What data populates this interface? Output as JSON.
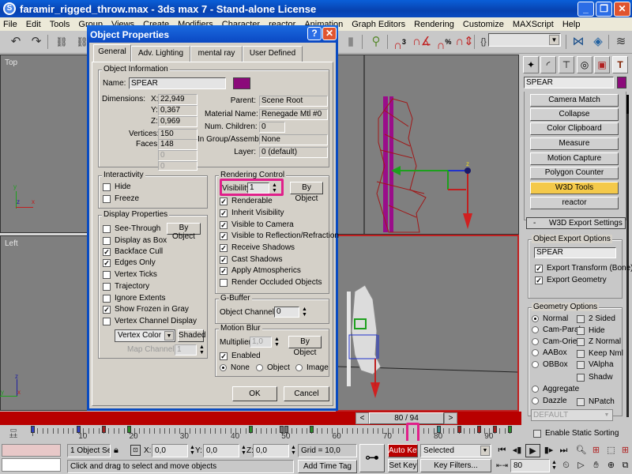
{
  "app": {
    "title": "faramir_rigged_throw.max - 3ds max 7  - Stand-alone License",
    "window_buttons": [
      "minimize",
      "restore",
      "close"
    ]
  },
  "menu": [
    "File",
    "Edit",
    "Tools",
    "Group",
    "Views",
    "Create",
    "Modifiers",
    "Character",
    "reactor",
    "Animation",
    "Graph Editors",
    "Rendering",
    "Customize",
    "MAXScript",
    "Help"
  ],
  "toolbar": {
    "icons": [
      "undo-icon",
      "redo-icon",
      "select-link-icon",
      "unlink-icon",
      "bind-space-warp-icon",
      "snap-3d-icon",
      "angle-snap-icon",
      "percent-snap-icon",
      "spinner-snap-icon",
      "edit-named-selection-icon",
      "mirror-icon",
      "align-icon",
      "layer-manager-icon"
    ],
    "snap_labels": {
      "snap3": "3",
      "percent": "%"
    },
    "named_selection_value": ""
  },
  "viewports": {
    "top_label": "Top",
    "left_label": "Left",
    "axis_top": {
      "y": "y",
      "z": "z",
      "x": "x"
    },
    "axis_left": {
      "z": "z",
      "y": "y",
      "x": "x"
    },
    "gizmo_label": "z"
  },
  "dialog": {
    "title": "Object Properties",
    "tabs": [
      "General",
      "Adv. Lighting",
      "mental ray",
      "User Defined"
    ],
    "active_tab": "General",
    "object_info": {
      "group_label": "Object Information",
      "name_label": "Name:",
      "name_value": "SPEAR",
      "color": "#8b0a7a",
      "dimensions_label": "Dimensions:",
      "x_label": "X:",
      "x": "22,949",
      "y_label": "Y:",
      "y": "0,367",
      "z_label": "Z:",
      "z": "0,969",
      "vertices_label": "Vertices:",
      "vertices": "150",
      "faces_label": "Faces:",
      "faces": "148",
      "extra1": "0",
      "extra2": "0",
      "parent_label": "Parent:",
      "parent": "Scene Root",
      "material_label": "Material Name:",
      "material": "Renegade Mtl #0",
      "children_label": "Num. Children:",
      "children": "0",
      "group_asm_label": "In Group/Assembly:",
      "group_asm": "None",
      "layer_label": "Layer:",
      "layer": "0 (default)"
    },
    "interactivity": {
      "group_label": "Interactivity",
      "items": [
        {
          "label": "Hide",
          "checked": false
        },
        {
          "label": "Freeze",
          "checked": false
        }
      ]
    },
    "display_properties": {
      "group_label": "Display Properties",
      "by_object": "By Object",
      "items": [
        {
          "label": "See-Through",
          "checked": false
        },
        {
          "label": "Display as Box",
          "checked": false
        },
        {
          "label": "Backface Cull",
          "checked": true
        },
        {
          "label": "Edges Only",
          "checked": true
        },
        {
          "label": "Vertex Ticks",
          "checked": false
        },
        {
          "label": "Trajectory",
          "checked": false
        },
        {
          "label": "Ignore Extents",
          "checked": false
        },
        {
          "label": "Show Frozen in Gray",
          "checked": true
        },
        {
          "label": "Vertex Channel Display",
          "checked": false
        }
      ],
      "vertex_mode": "Vertex Color",
      "shaded_button": "Shaded",
      "map_channel_label": "Map Channel:",
      "map_channel": "1"
    },
    "rendering_control": {
      "group_label": "Rendering Control",
      "visibility_label": "Visibility:",
      "visibility": "1",
      "by_object": "By Object",
      "items": [
        {
          "label": "Renderable",
          "checked": true
        },
        {
          "label": "Inherit Visibility",
          "checked": true
        },
        {
          "label": "Visible to Camera",
          "checked": true
        },
        {
          "label": "Visible to Reflection/Refraction",
          "checked": true
        },
        {
          "label": "Receive Shadows",
          "checked": true
        },
        {
          "label": "Cast Shadows",
          "checked": true
        },
        {
          "label": "Apply Atmospherics",
          "checked": true
        },
        {
          "label": "Render Occluded Objects",
          "checked": false
        }
      ]
    },
    "gbuffer": {
      "group_label": "G-Buffer",
      "channel_label": "Object Channel:",
      "channel": "0"
    },
    "motion_blur": {
      "group_label": "Motion Blur",
      "multiplier_label": "Multiplier:",
      "multiplier": "1,0",
      "by_object": "By Object",
      "enabled_label": "Enabled",
      "enabled": true,
      "modes": [
        {
          "label": "None",
          "selected": true
        },
        {
          "label": "Object",
          "selected": false
        },
        {
          "label": "Image",
          "selected": false
        }
      ]
    },
    "ok": "OK",
    "cancel": "Cancel"
  },
  "command_panel": {
    "tabs": [
      "create-icon",
      "modify-icon",
      "hierarchy-icon",
      "motion-icon",
      "display-icon",
      "utilities-icon"
    ],
    "object_name": "SPEAR",
    "object_color": "#8b0a7a",
    "utilities": [
      {
        "label": "Camera Match",
        "active": false
      },
      {
        "label": "Collapse",
        "active": false
      },
      {
        "label": "Color Clipboard",
        "active": false
      },
      {
        "label": "Measure",
        "active": false
      },
      {
        "label": "Motion Capture",
        "active": false
      },
      {
        "label": "Polygon Counter",
        "active": false
      },
      {
        "label": "W3D Tools",
        "active": true
      },
      {
        "label": "reactor",
        "active": false
      }
    ],
    "rollout_sign": "-",
    "rollout_title": "W3D Export Settings",
    "export_options": {
      "group_label": "Object Export Options",
      "name": "SPEAR",
      "export_transform": "Export Transform (Bone)",
      "export_transform_checked": true,
      "export_geometry": "Export Geometry",
      "export_geometry_checked": true
    },
    "geometry_options": {
      "group_label": "Geometry Options",
      "radios": [
        {
          "label": "Normal",
          "selected": true
        },
        {
          "label": "Cam-Paral.",
          "selected": false
        },
        {
          "label": "Cam-Orient",
          "selected": false
        },
        {
          "label": "AABox",
          "selected": false
        },
        {
          "label": "OBBox",
          "selected": false
        },
        {
          "label": "Aggregate",
          "selected": false
        },
        {
          "label": "Dazzle",
          "selected": false
        }
      ],
      "checks": [
        {
          "label": "2 Sided",
          "checked": false
        },
        {
          "label": "Hide",
          "checked": false
        },
        {
          "label": "Z Normal",
          "checked": false
        },
        {
          "label": "Keep Nml",
          "checked": false
        },
        {
          "label": "VAlpha",
          "checked": false
        },
        {
          "label": "Shadw",
          "checked": false
        },
        {
          "label": "NPatch",
          "checked": false
        }
      ],
      "dazzle_type": "DEFAULT",
      "static_sorting": "Enable Static Sorting",
      "static_sorting_checked": false
    }
  },
  "timeline": {
    "frame_display": "80 / 94",
    "current_frame": 80,
    "total_frames": 94,
    "prev": "<",
    "next": ">",
    "tick_labels": [
      "10",
      "20",
      "30",
      "40",
      "50",
      "60",
      "70",
      "80",
      "90"
    ],
    "keys": [
      0,
      9,
      14,
      19,
      43,
      49,
      50,
      55,
      80,
      84,
      88,
      91,
      94
    ]
  },
  "status": {
    "selection": "1 Object Sele",
    "x_label": "X:",
    "x": "0,0",
    "y_label": "Y:",
    "y": "0,0",
    "z_label": "Z:",
    "z": "0,0",
    "grid": "Grid = 10,0",
    "prompt": "Click and drag to select and move objects",
    "add_time_tag": "Add Time Tag",
    "auto_key": "Auto Key",
    "set_key": "Set Key",
    "key_mode": "Selected",
    "key_filters": "Key Filters...",
    "frame": "80"
  }
}
